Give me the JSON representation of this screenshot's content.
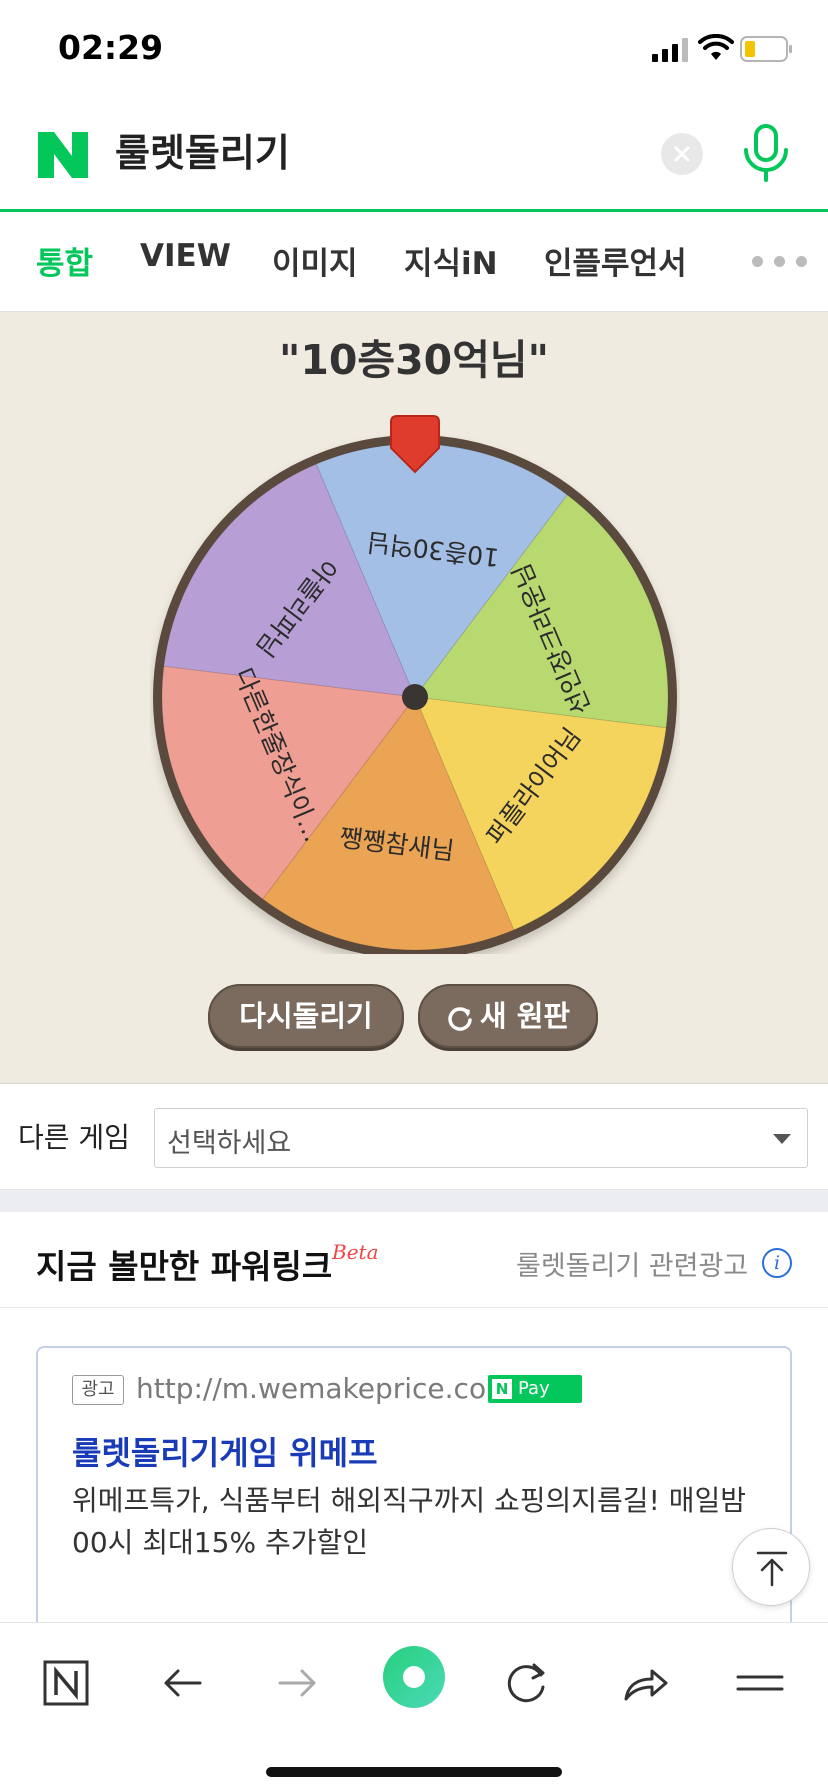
{
  "status": {
    "time": "02:29"
  },
  "search": {
    "query": "룰렛돌리기"
  },
  "tabs": [
    "통합",
    "VIEW",
    "이미지",
    "지식iN",
    "인플루언서"
  ],
  "roulette": {
    "result": "\"10층30억님\"",
    "pointer_color": "#e03c2e",
    "segments": [
      {
        "label": "10층30억님",
        "color": "#a4bfe6"
      },
      {
        "label": "선인장크라운님",
        "color": "#b8d870"
      },
      {
        "label": "퍼플라이어님",
        "color": "#f5d45e"
      },
      {
        "label": "쨍쨍참새님",
        "color": "#eaa454"
      },
      {
        "label": "다른한줄장식이…",
        "color": "#ee9e92"
      },
      {
        "label": "아플리파님",
        "color": "#b79fd6"
      }
    ],
    "respin_label": "다시돌리기",
    "new_label": "새 원판"
  },
  "other_game": {
    "label": "다른 게임",
    "placeholder": "선택하세요"
  },
  "powerlink": {
    "title": "지금 볼만한 파워링크",
    "beta": "Beta",
    "related": "룰렛돌리기 관련광고",
    "ad": {
      "badge": "광고",
      "url": "http://m.wemakeprice.com",
      "pay": "Pay",
      "title": "룰렛돌리기게임 위메프",
      "description": "위메프특가, 식품부터 해외직구까지 쇼핑의지름길! 매일밤 00시 최대15% 추가할인"
    }
  },
  "colors": {
    "brand": "#03c75a",
    "wheel_rim": "#5a4a3e",
    "button": "#7a6b5e"
  }
}
